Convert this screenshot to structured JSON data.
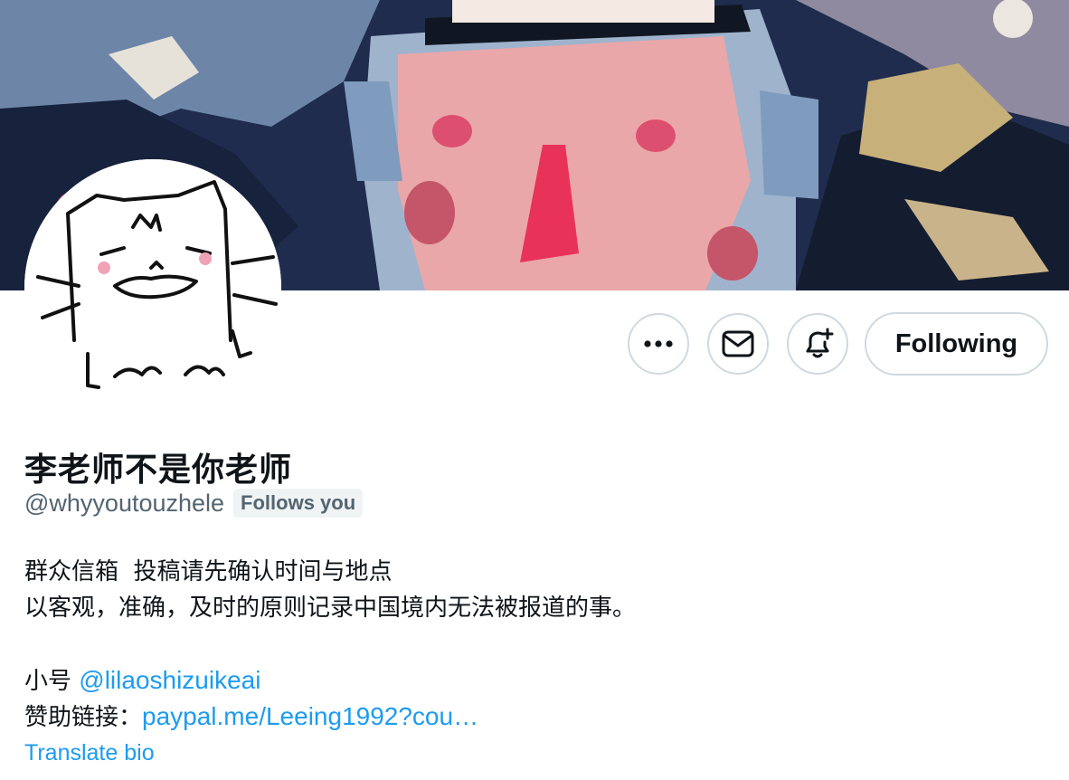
{
  "profile": {
    "display_name": "李老师不是你老师",
    "handle": "@whyyoutouzhele",
    "follows_you": "Follows you"
  },
  "bio": {
    "line1": "群众信箱  投稿请先确认时间与地点",
    "line2": "以客观，准确，及时的原则记录中国境内无法被报道的事。",
    "alt_account_label": "小号",
    "alt_account_link": "@lilaoshizuikeai",
    "sponsor_label": "赞助链接：",
    "sponsor_link": "paypal.me/Leeing1992?cou…"
  },
  "actions": {
    "more_icon": "more-icon",
    "message_icon": "envelope-icon",
    "notify_icon": "bell-plus-icon",
    "follow_label": "Following"
  },
  "translate_bio": "Translate bio",
  "colors": {
    "accent": "#1d9bf0",
    "text": "#0f1419",
    "muted": "#536471",
    "border": "#cfd9de"
  }
}
